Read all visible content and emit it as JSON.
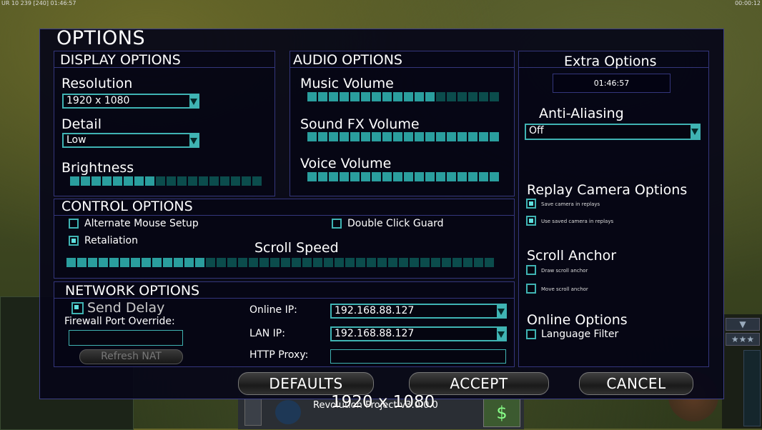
{
  "hud": {
    "left_text": "UR 10 239 [240] 01:46:57",
    "right_text": "00:00:12"
  },
  "background": {
    "bottom_label": "Revolution Project v3.0.0.0",
    "resolution_overlay": "1920 x 1080"
  },
  "title": "OPTIONS",
  "display": {
    "title": "DISPLAY OPTIONS",
    "resolution_label": "Resolution",
    "resolution_value": "1920 x 1080",
    "detail_label": "Detail",
    "detail_value": "Low",
    "brightness_label": "Brightness",
    "brightness_level": 0.45
  },
  "audio": {
    "title": "AUDIO OPTIONS",
    "music_label": "Music Volume",
    "music_level": 0.67,
    "sfx_label": "Sound FX Volume",
    "sfx_level": 1.0,
    "voice_label": "Voice Volume",
    "voice_level": 1.0
  },
  "extra": {
    "title": "Extra Options",
    "clock": "01:46:57",
    "aa_label": "Anti-Aliasing",
    "aa_value": "Off",
    "replay_title": "Replay Camera Options",
    "save_camera_label": "Save camera in replays",
    "save_camera_checked": true,
    "use_camera_label": "Use saved camera in replays",
    "use_camera_checked": true,
    "scroll_anchor_title": "Scroll Anchor",
    "draw_anchor_label": "Draw scroll anchor",
    "draw_anchor_checked": false,
    "move_anchor_label": "Move scroll anchor",
    "move_anchor_checked": false,
    "online_title": "Online Options",
    "language_filter_label": "Language Filter",
    "language_filter_checked": false
  },
  "control": {
    "title": "CONTROL OPTIONS",
    "alt_mouse_label": "Alternate Mouse Setup",
    "alt_mouse_checked": false,
    "double_click_label": "Double Click Guard",
    "double_click_checked": false,
    "retaliation_label": "Retaliation",
    "retaliation_checked": true,
    "scroll_speed_label": "Scroll Speed",
    "scroll_speed_level": 0.32
  },
  "network": {
    "title": "NETWORK OPTIONS",
    "send_delay_label": "Send Delay",
    "send_delay_checked": true,
    "firewall_label": "Firewall Port Override:",
    "firewall_value": "",
    "refresh_nat_label": "Refresh NAT",
    "online_ip_label": "Online IP:",
    "online_ip_value": "192.168.88.127",
    "lan_ip_label": "LAN IP:",
    "lan_ip_value": "192.168.88.127",
    "http_proxy_label": "HTTP Proxy:",
    "http_proxy_value": ""
  },
  "buttons": {
    "defaults": "DEFAULTS",
    "accept": "ACCEPT",
    "cancel": "CANCEL"
  },
  "colors": {
    "accent": "#3fb3b3",
    "slider_on": "#2a9e9e",
    "slider_off": "#0b4c4c",
    "border": "#34367c"
  },
  "icons": [
    "dropdown-arrow-icon",
    "money-icon",
    "radar-eye-icon",
    "star-rank-icon"
  ]
}
